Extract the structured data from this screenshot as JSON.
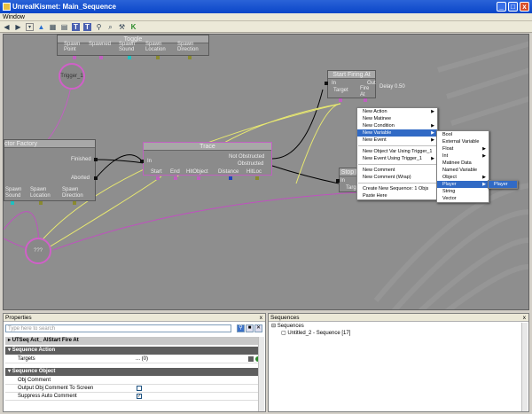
{
  "window": {
    "title": "UnrealKismet: Main_Sequence",
    "menu": "Window",
    "buttons": [
      "_",
      "□",
      "x"
    ]
  },
  "toolbar_icons": [
    "back-icon",
    "forward-icon",
    "dropdown-icon",
    "up-icon",
    "open-icon",
    "print-icon",
    "text-icon",
    "text2-icon",
    "search-icon",
    "zoom-icon",
    "tool-icon",
    "k-icon"
  ],
  "nodes": {
    "toggle": {
      "title": "Toggle",
      "pins": [
        "Spawn\nPoint",
        "Spawned",
        "Spawn\nSound",
        "Spawn\nLocation",
        "Spawn\nDirection"
      ]
    },
    "trigger": {
      "label": "Trigger_1"
    },
    "start_firing": {
      "title": "Start Firing At",
      "in": "In",
      "out": "Out",
      "target": "Target",
      "fire_at": "Fire\nAt"
    },
    "delay": {
      "label": "Delay 0.50"
    },
    "actor_factory": {
      "title": "ctor Factory",
      "finished": "Finished",
      "aborted": "Aborted",
      "pins": [
        "Spawn\nSound",
        "Spawn\nLocation",
        "Spawn\nDirection"
      ]
    },
    "trace": {
      "title": "Trace",
      "in": "In",
      "not_obstructed": "Not Obstructed",
      "obstructed": "Obstructed",
      "pins": [
        "Start",
        "End",
        "HitObject",
        "Distance",
        "HitLoc"
      ]
    },
    "stop_firing": {
      "title": "Stop F",
      "in": "In",
      "target": "Targ"
    },
    "circle_var": {
      "label": "???"
    }
  },
  "context_menu": {
    "items": [
      {
        "label": "New Action",
        "sub": true
      },
      {
        "label": "New Matinee",
        "sub": false
      },
      {
        "label": "New Condition",
        "sub": true
      },
      {
        "label": "New Variable",
        "sub": true,
        "selected": true
      },
      {
        "label": "New Event",
        "sub": true
      },
      {
        "sep": true
      },
      {
        "label": "New Object Var Using Trigger_1",
        "sub": false
      },
      {
        "label": "New Event Using Trigger_1",
        "sub": true
      },
      {
        "sep": true
      },
      {
        "label": "New Comment",
        "sub": false
      },
      {
        "label": "New Comment (Wrap)",
        "sub": false
      },
      {
        "sep": true
      },
      {
        "label": "Create New Sequence: 1 Objs",
        "sub": false
      },
      {
        "label": "Paste Here",
        "sub": false
      }
    ],
    "variable_submenu": [
      {
        "label": "Bool",
        "sub": false
      },
      {
        "label": "External Variable",
        "sub": false
      },
      {
        "label": "Float",
        "sub": true
      },
      {
        "label": "Int",
        "sub": true
      },
      {
        "label": "Matinee Data",
        "sub": false
      },
      {
        "label": "Named Variable",
        "sub": false
      },
      {
        "label": "Object",
        "sub": true
      },
      {
        "label": "Player",
        "sub": true,
        "selected": true
      },
      {
        "label": "String",
        "sub": false
      },
      {
        "label": "Vector",
        "sub": false
      }
    ],
    "player_submenu": [
      {
        "label": "Player",
        "selected": true
      }
    ]
  },
  "properties": {
    "header": "Properties",
    "close": "x",
    "search_placeholder": "Type here to search",
    "selected_object": "UTSeq Act_ AIStart Fire At",
    "sections": [
      {
        "title": "Sequence Action",
        "rows": [
          {
            "key": "Targets",
            "value": "... (0)"
          }
        ]
      },
      {
        "title": "Sequence Object",
        "rows": [
          {
            "key": "Obj Comment",
            "value": ""
          },
          {
            "key": "Output Obj Comment To Screen",
            "checked": false
          },
          {
            "key": "Suppress Auto Comment",
            "checked": true
          }
        ]
      }
    ]
  },
  "sequences": {
    "header": "Sequences",
    "close": "x",
    "root": "Sequences",
    "child": "Untitled_2 - Sequence [17]"
  }
}
